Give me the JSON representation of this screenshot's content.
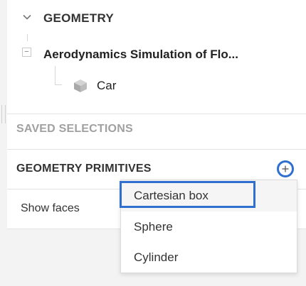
{
  "geometry": {
    "section_title": "GEOMETRY",
    "item_label": "Aerodynamics Simulation of Flo...",
    "child_label": "Car",
    "collapse_glyph": "−",
    "icons": {
      "section_chevron": "chevron-down-icon",
      "collapse": "collapse-minus-icon",
      "child": "cube-icon"
    }
  },
  "saved_selections": {
    "title": "SAVED SELECTIONS"
  },
  "geometry_primitives": {
    "title": "GEOMETRY PRIMITIVES",
    "add_icon": "plus-circle-icon",
    "accent_color": "#2f6fd0"
  },
  "show_faces": {
    "label": "Show faces"
  },
  "dropdown": {
    "items": [
      {
        "label": "Cartesian box",
        "selected": true
      },
      {
        "label": "Sphere",
        "selected": false
      },
      {
        "label": "Cylinder",
        "selected": false
      }
    ]
  }
}
